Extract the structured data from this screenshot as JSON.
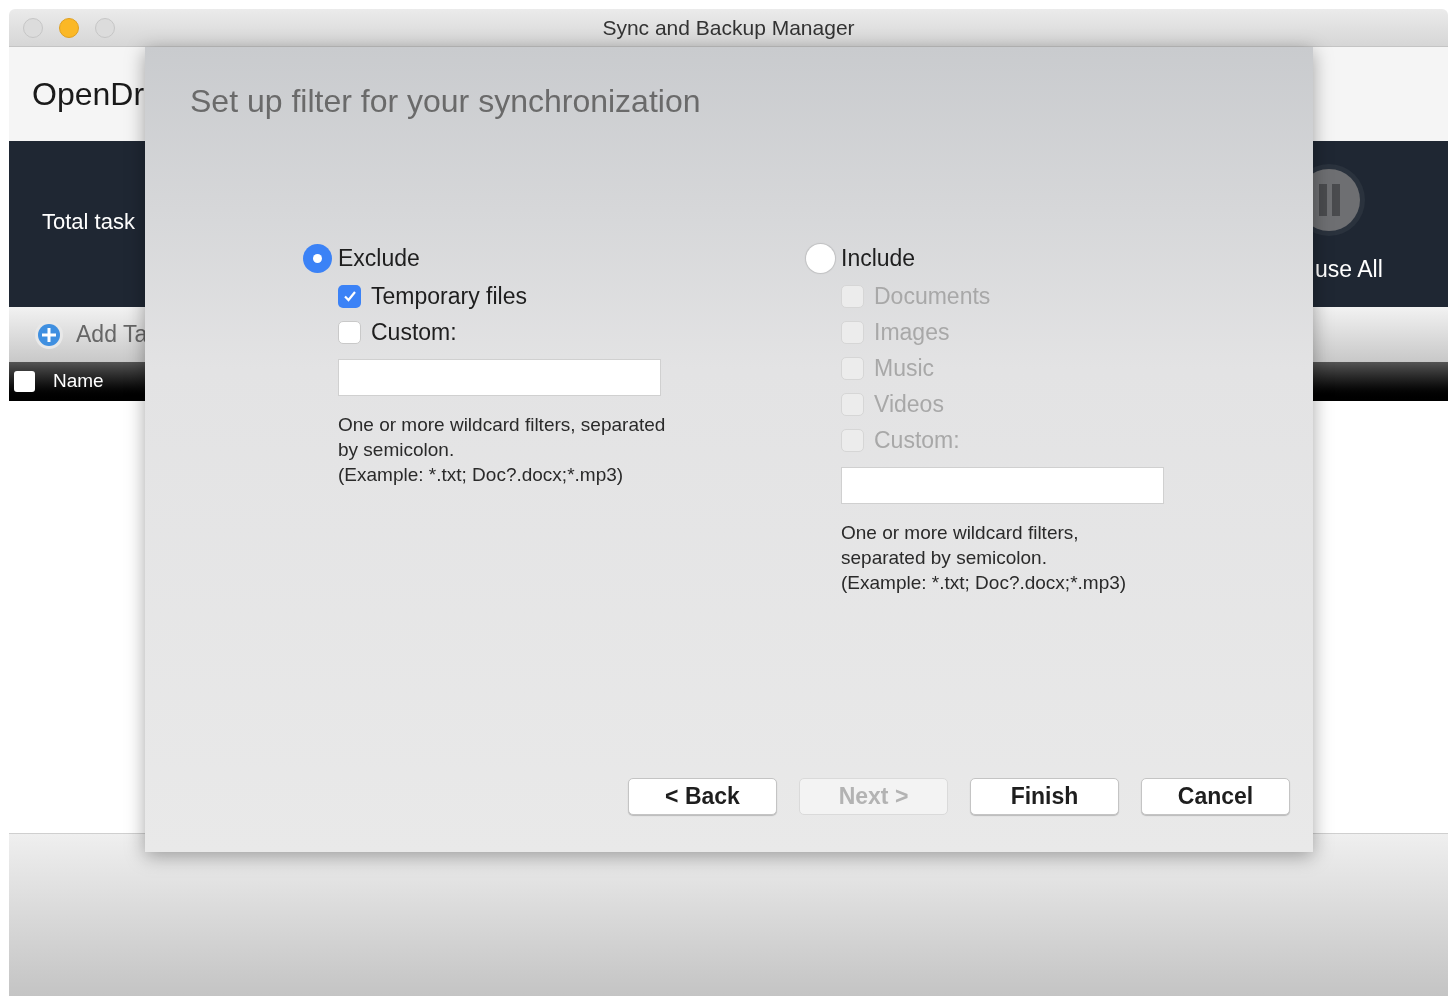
{
  "window": {
    "title": "Sync and Backup Manager"
  },
  "app": {
    "title": "OpenDr",
    "summary_label": "Total task",
    "pause_all_label": "use All",
    "add_task_label": "Add Ta",
    "table": {
      "select_all_checked": false,
      "columns": [
        {
          "label": "Name"
        }
      ]
    }
  },
  "dialog": {
    "title": "Set up filter for your synchronization",
    "groups": [
      {
        "label": "Exclude",
        "selected": true,
        "options": [
          {
            "label": "Temporary files",
            "checked": true,
            "disabled": false
          },
          {
            "label": "Custom:",
            "checked": false,
            "disabled": false
          }
        ],
        "hint": "One or more wildcard filters, separated by semicolon.",
        "example": "(Example: *.txt; Doc?.docx;*.mp3)"
      },
      {
        "label": "Include",
        "selected": false,
        "options": [
          {
            "label": "Documents",
            "checked": false,
            "disabled": true
          },
          {
            "label": "Images",
            "checked": false,
            "disabled": true
          },
          {
            "label": "Music",
            "checked": false,
            "disabled": true
          },
          {
            "label": "Videos",
            "checked": false,
            "disabled": true
          },
          {
            "label": "Custom:",
            "checked": false,
            "disabled": true
          }
        ],
        "hint": "One or more wildcard filters, separated by semicolon.",
        "example": "(Example: *.txt; Doc?.docx;*.mp3)"
      }
    ],
    "buttons": [
      {
        "label": "< Back",
        "disabled": false
      },
      {
        "label": "Next >",
        "disabled": true
      },
      {
        "label": "Finish",
        "disabled": false
      },
      {
        "label": "Cancel",
        "disabled": false
      }
    ]
  }
}
